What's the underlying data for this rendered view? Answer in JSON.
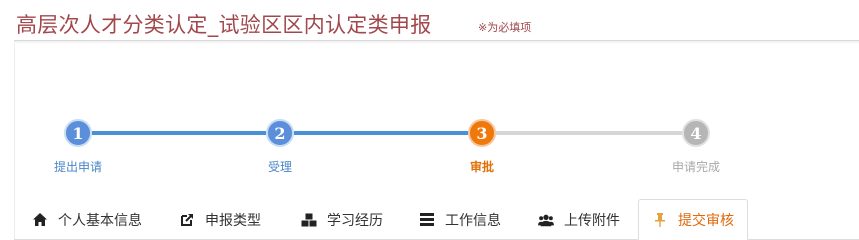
{
  "header": {
    "title": "高层次人才分类认定_试验区区内认定类申报",
    "required_note": "※为必填项"
  },
  "steps": [
    {
      "number": "1",
      "label": "提出申请",
      "state": "done"
    },
    {
      "number": "2",
      "label": "受理",
      "state": "done"
    },
    {
      "number": "3",
      "label": "审批",
      "state": "active"
    },
    {
      "number": "4",
      "label": "申请完成",
      "state": "todo"
    }
  ],
  "tabs": [
    {
      "label": "个人基本信息",
      "icon": "home-icon",
      "active": false
    },
    {
      "label": "申报类型",
      "icon": "external-link-icon",
      "active": false
    },
    {
      "label": "学习经历",
      "icon": "cubes-icon",
      "active": false
    },
    {
      "label": "工作信息",
      "icon": "server-icon",
      "active": false
    },
    {
      "label": "上传附件",
      "icon": "users-icon",
      "active": false
    },
    {
      "label": "提交审核",
      "icon": "pushpin-icon",
      "active": true
    }
  ],
  "colors": {
    "title": "#a1484c",
    "step_done": "#5b8fdc",
    "step_active": "#f0780a",
    "step_todo": "#b6b6b6",
    "active_tab_text": "#e16a0a"
  }
}
